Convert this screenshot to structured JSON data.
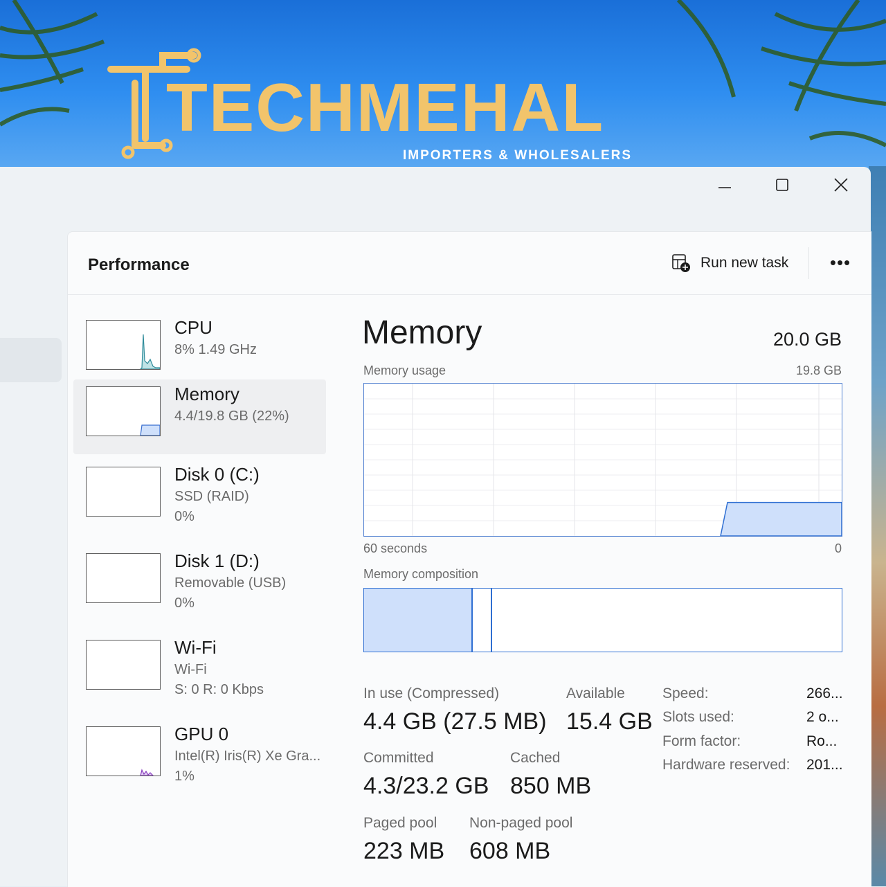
{
  "banner": {
    "brand": "TECHMEHAL",
    "tagline": "IMPORTERS & WHOLESALERS"
  },
  "window": {
    "minimize_icon": "minimize-icon",
    "maximize_icon": "maximize-icon",
    "close_icon": "close-icon"
  },
  "header": {
    "title": "Performance",
    "run_new_task": "Run new task",
    "more": "•••"
  },
  "devices": [
    {
      "name": "CPU",
      "line1": "8%  1.49 GHz",
      "line2": "",
      "selected": false,
      "graph_color": "#2e8b9a"
    },
    {
      "name": "Memory",
      "line1": "4.4/19.8 GB (22%)",
      "line2": "",
      "selected": true,
      "graph_color": "#3a6fd0"
    },
    {
      "name": "Disk 0 (C:)",
      "line1": "SSD (RAID)",
      "line2": "0%",
      "selected": false,
      "graph_color": "#4b9a2e"
    },
    {
      "name": "Disk 1 (D:)",
      "line1": "Removable (USB)",
      "line2": "0%",
      "selected": false,
      "graph_color": "#4b9a2e"
    },
    {
      "name": "Wi-Fi",
      "line1": "Wi-Fi",
      "line2": "S: 0  R: 0 Kbps",
      "selected": false,
      "graph_color": "#a0522d"
    },
    {
      "name": "GPU 0",
      "line1": "Intel(R) Iris(R) Xe Gra...",
      "line2": "1%",
      "selected": false,
      "graph_color": "#8a3fc0"
    }
  ],
  "detail": {
    "title": "Memory",
    "total": "20.0 GB",
    "usage_label": "Memory usage",
    "usage_max": "19.8 GB",
    "time_left": "60 seconds",
    "time_right": "0",
    "usage_fraction": 0.22,
    "composition_label": "Memory composition",
    "composition": {
      "in_use_fraction": 0.225,
      "modified_fraction": 0.04
    },
    "stats": {
      "in_use_label": "In use (Compressed)",
      "in_use_value": "4.4 GB (27.5 MB)",
      "available_label": "Available",
      "available_value": "15.4 GB",
      "committed_label": "Committed",
      "committed_value": "4.3/23.2 GB",
      "cached_label": "Cached",
      "cached_value": "850 MB",
      "paged_label": "Paged pool",
      "paged_value": "223 MB",
      "nonpaged_label": "Non-paged pool",
      "nonpaged_value": "608 MB"
    },
    "specs": [
      {
        "label": "Speed:",
        "value": "266..."
      },
      {
        "label": "Slots used:",
        "value": "2 o..."
      },
      {
        "label": "Form factor:",
        "value": "Ro..."
      },
      {
        "label": "Hardware reserved:",
        "value": "201..."
      }
    ]
  },
  "colors": {
    "accent": "#2f6fd2",
    "fill": "#cfe0fb"
  }
}
